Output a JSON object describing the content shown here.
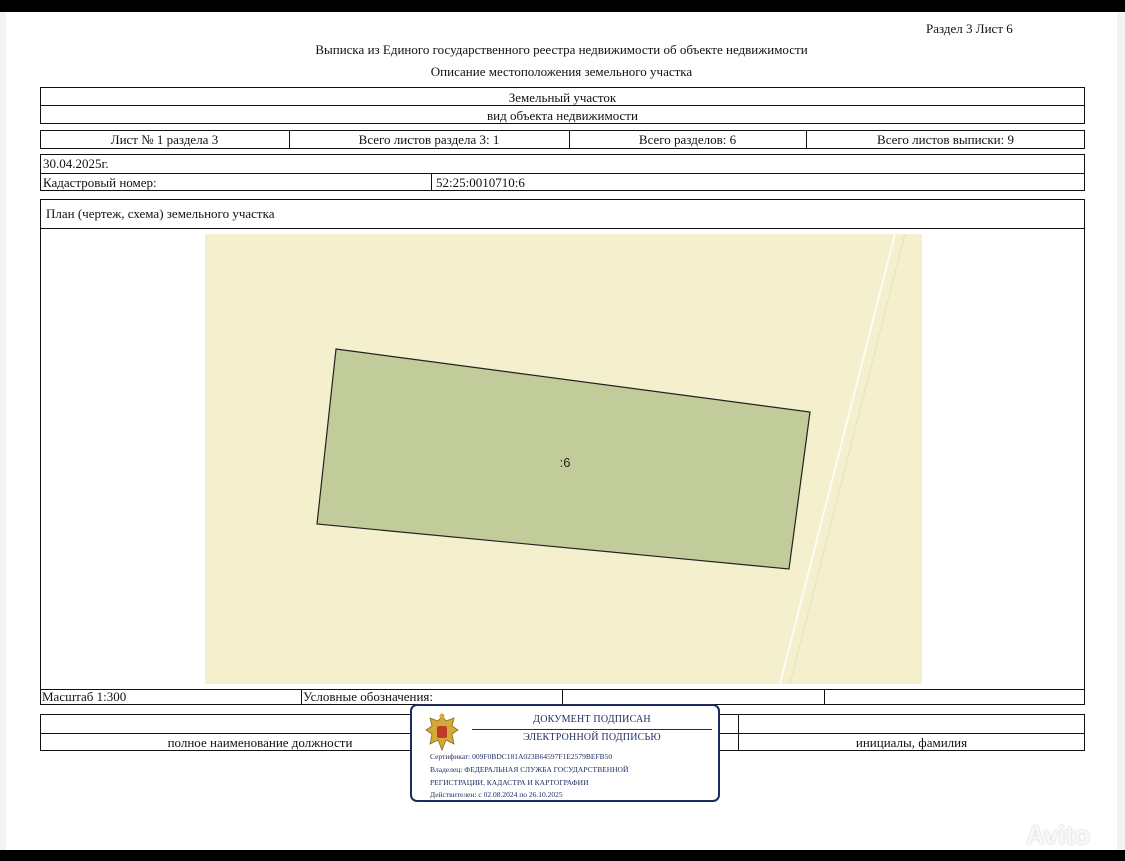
{
  "header": {
    "section_sheet": "Раздел 3   Лист 6",
    "title": "Выписка из Единого государственного реестра недвижимости об объекте недвижимости",
    "subtitle": "Описание местоположения земельного участка"
  },
  "object": {
    "type": "Земельный участок",
    "type_caption": "вид объекта недвижимости"
  },
  "sheet_info": {
    "sheet": "Лист № 1 раздела 3",
    "total_sheets_section": "Всего листов раздела 3: 1",
    "total_sections": "Всего разделов: 6",
    "total_sheets_extract": "Всего листов выписки: 9"
  },
  "date": "30.04.2025г.",
  "cadastral": {
    "label": "Кадастровый номер:",
    "value": "52:25:0010710:6"
  },
  "plan": {
    "title": "План (чертеж, схема) земельного участка",
    "parcel_label": ":6",
    "background_color": "#f4efcc",
    "parcel_color": "#c2cc9a"
  },
  "legend_row": {
    "scale": "Масштаб 1:300",
    "legend": "Условные обозначения:"
  },
  "signature_row": {
    "position": "полное наименование должности",
    "initials": "инициалы, фамилия"
  },
  "stamp": {
    "line1": "ДОКУМЕНТ ПОДПИСАН",
    "line2": "ЭЛЕКТРОННОЙ ПОДПИСЬЮ",
    "certificate": "Сертификат: 009F0BDC181A023B64597F1E2579BEFB50",
    "owner_1": "Владелец: ФЕДЕРАЛЬНАЯ СЛУЖБА ГОСУДАРСТВЕННОЙ",
    "owner_2": "РЕГИСТРАЦИИ, КАДАСТРА И КАРТОГРАФИИ",
    "valid": "Действителен: с 02.08.2024 по 26.10.2025",
    "color": "#1d2a5e"
  },
  "watermark": {
    "text": "Avito"
  }
}
